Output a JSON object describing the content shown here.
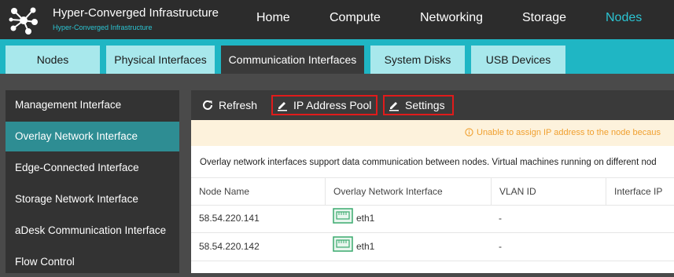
{
  "header": {
    "title": "Hyper-Converged Infrastructure",
    "subtitle": "Hyper-Converged Infrastructure",
    "nav": [
      {
        "label": "Home",
        "active": false
      },
      {
        "label": "Compute",
        "active": false
      },
      {
        "label": "Networking",
        "active": false
      },
      {
        "label": "Storage",
        "active": false
      },
      {
        "label": "Nodes",
        "active": true
      }
    ]
  },
  "tabs": [
    {
      "label": "Nodes",
      "active": false
    },
    {
      "label": "Physical Interfaces",
      "active": false
    },
    {
      "label": "Communication Interfaces",
      "active": true
    },
    {
      "label": "System Disks",
      "active": false
    },
    {
      "label": "USB Devices",
      "active": false
    }
  ],
  "sidebar": {
    "items": [
      {
        "label": "Management Interface",
        "active": false
      },
      {
        "label": "Overlay Network Interface",
        "active": true
      },
      {
        "label": "Edge-Connected Interface",
        "active": false
      },
      {
        "label": "Storage Network Interface",
        "active": false
      },
      {
        "label": "aDesk Communication Interface",
        "active": false
      },
      {
        "label": "Flow Control",
        "active": false
      }
    ]
  },
  "toolbar": {
    "refresh_label": "Refresh",
    "ip_pool_label": "IP Address Pool",
    "settings_label": "Settings"
  },
  "warning": {
    "icon": "info-circle-icon",
    "text": "Unable to assign IP address to the node becaus"
  },
  "description": "Overlay network interfaces support data communication between nodes. Virtual machines running on different nod",
  "table": {
    "columns": [
      "Node Name",
      "Overlay Network Interface",
      "VLAN ID",
      "Interface IP"
    ],
    "rows": [
      {
        "node": "58.54.220.141",
        "iface": "eth1",
        "vlan": "-",
        "ip": ""
      },
      {
        "node": "58.54.220.142",
        "iface": "eth1",
        "vlan": "-",
        "ip": ""
      }
    ]
  },
  "colors": {
    "accent": "#1fb6c4",
    "active_nav": "#2bc4d2",
    "highlight_box": "#e01b1b",
    "warning_text": "#f0a030",
    "warning_bg": "#fdf2dc",
    "nic_icon": "#3aaa6e"
  }
}
